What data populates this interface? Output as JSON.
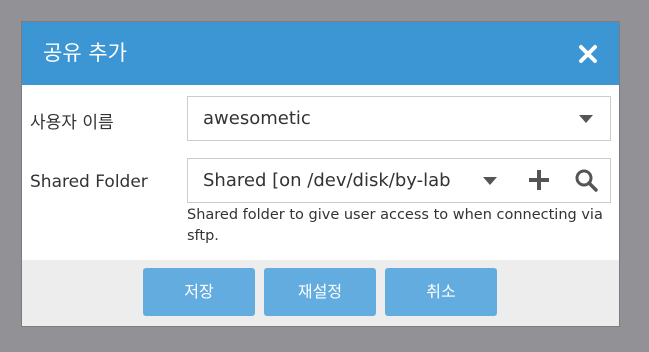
{
  "dialog": {
    "title": "공유 추가"
  },
  "form": {
    "user_label": "사용자 이름",
    "user_value": "awesometic",
    "folder_label": "Shared Folder",
    "folder_value": "Shared [on /dev/disk/by-lab",
    "folder_hint": "Shared folder to give user access to when connecting via sftp."
  },
  "footer": {
    "save_label": "저장",
    "reset_label": "재설정",
    "cancel_label": "취소"
  },
  "icons": {
    "close": "close-icon",
    "dropdown": "chevron-down-icon",
    "add": "plus-icon",
    "search": "search-icon"
  },
  "colors": {
    "titlebar": "#3b96d3",
    "button": "#63acdf",
    "footer": "#ededed",
    "backdrop": "#929296"
  }
}
